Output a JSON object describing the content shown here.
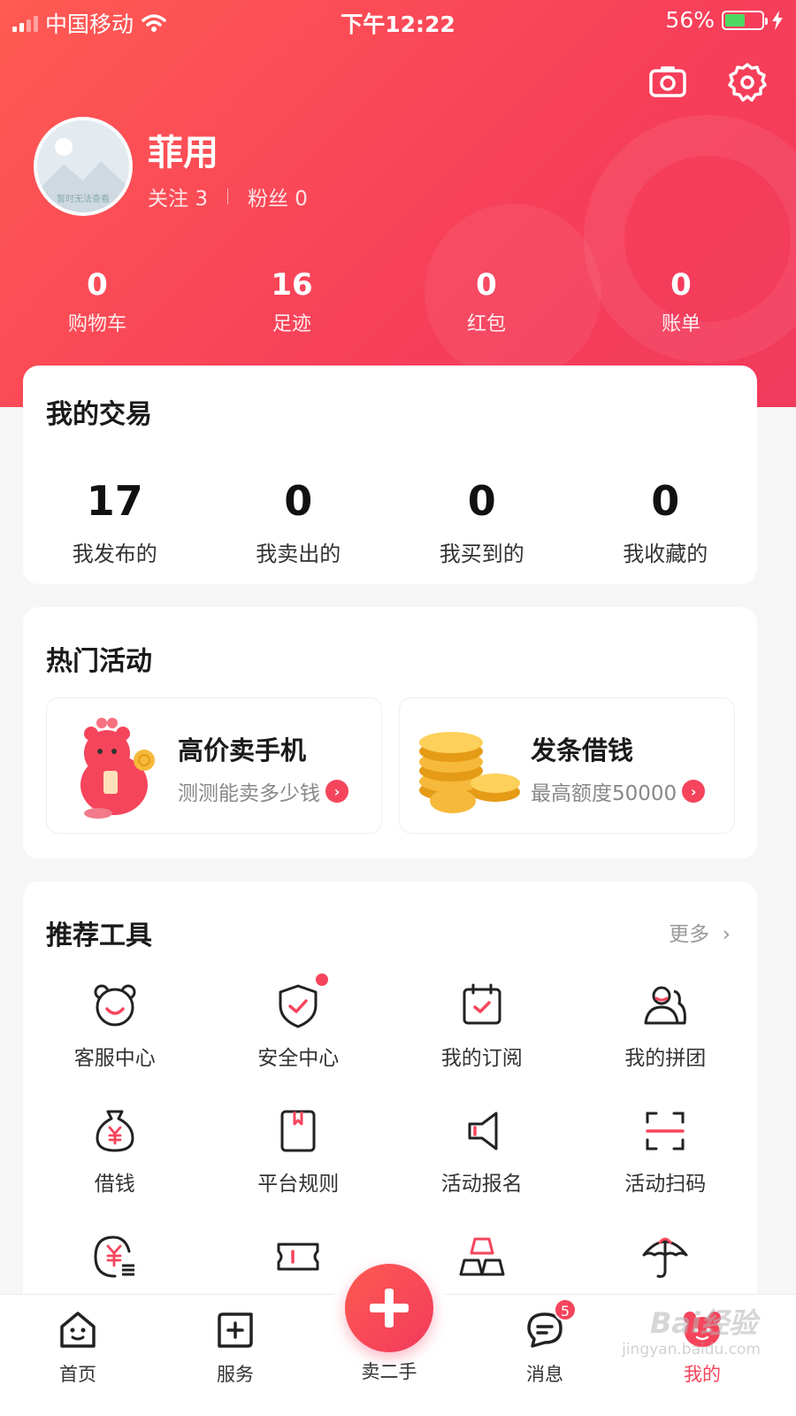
{
  "status_bar": {
    "carrier": "中国移动",
    "time": "下午12:22",
    "battery": "56%",
    "battery_level": 0.56
  },
  "profile": {
    "name": "菲用",
    "follow_label": "关注",
    "follow_count": "3",
    "fans_label": "粉丝",
    "fans_count": "0",
    "avatar_placeholder": "暂时无法查看"
  },
  "stats": [
    {
      "value": "0",
      "label": "购物车"
    },
    {
      "value": "16",
      "label": "足迹"
    },
    {
      "value": "0",
      "label": "红包"
    },
    {
      "value": "0",
      "label": "账单"
    }
  ],
  "trade": {
    "title": "我的交易",
    "items": [
      {
        "value": "17",
        "label": "我发布的"
      },
      {
        "value": "0",
        "label": "我卖出的"
      },
      {
        "value": "0",
        "label": "我买到的"
      },
      {
        "value": "0",
        "label": "我收藏的"
      }
    ]
  },
  "hot": {
    "title": "热门活动",
    "promos": [
      {
        "title": "高价卖手机",
        "subtitle": "测测能卖多少钱"
      },
      {
        "title": "发条借钱",
        "subtitle": "最高额度50000"
      }
    ]
  },
  "tools": {
    "title": "推荐工具",
    "more": "更多",
    "items": [
      {
        "label": "客服中心",
        "icon": "bear-face-icon"
      },
      {
        "label": "安全中心",
        "icon": "shield-check-icon"
      },
      {
        "label": "我的订阅",
        "icon": "calendar-check-icon"
      },
      {
        "label": "我的拼团",
        "icon": "group-icon"
      },
      {
        "label": "借钱",
        "icon": "money-bag-icon"
      },
      {
        "label": "平台规则",
        "icon": "rulebook-icon"
      },
      {
        "label": "活动报名",
        "icon": "megaphone-icon"
      },
      {
        "label": "活动扫码",
        "icon": "scan-icon"
      },
      {
        "label": "",
        "icon": "yuan-list-icon"
      },
      {
        "label": "",
        "icon": "ticket-icon"
      },
      {
        "label": "",
        "icon": "gold-bars-icon"
      },
      {
        "label": "",
        "icon": "umbrella-icon"
      }
    ]
  },
  "tabbar": {
    "home": "首页",
    "service": "服务",
    "sell": "卖二手",
    "messages": "消息",
    "messages_badge": "5",
    "mine": "我的"
  },
  "watermark": {
    "brand": "Bai经验",
    "url": "jingyan.baidu.com"
  },
  "colors": {
    "accent": "#f5455c",
    "header_start": "#ff5a52",
    "header_end": "#f23a5c"
  }
}
